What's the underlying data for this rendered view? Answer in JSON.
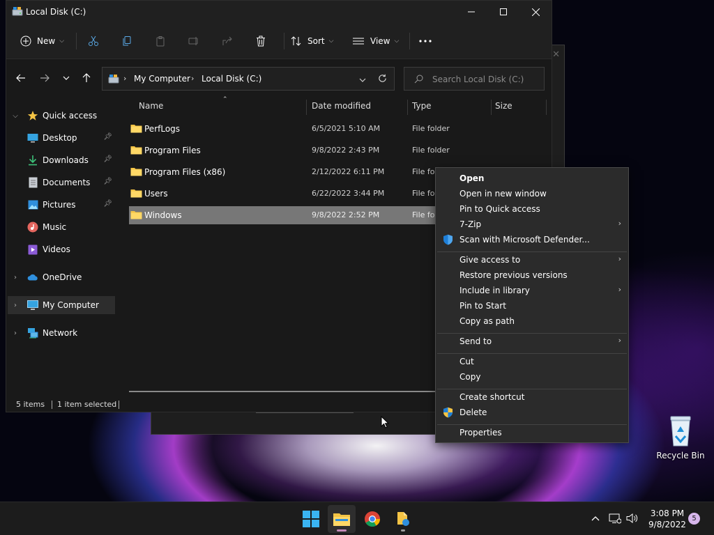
{
  "window": {
    "title": "Local Disk (C:)"
  },
  "toolbar": {
    "new_label": "New",
    "sort_label": "Sort",
    "view_label": "View"
  },
  "address": {
    "crumbs": [
      "My Computer",
      "Local Disk (C:)"
    ]
  },
  "search": {
    "placeholder": "Search Local Disk (C:)"
  },
  "sidebar": {
    "items": [
      {
        "label": "Quick access",
        "icon": "star-icon"
      },
      {
        "label": "Desktop",
        "icon": "desktop-icon",
        "pinned": true
      },
      {
        "label": "Downloads",
        "icon": "download-icon",
        "pinned": true
      },
      {
        "label": "Documents",
        "icon": "document-icon",
        "pinned": true
      },
      {
        "label": "Pictures",
        "icon": "picture-icon",
        "pinned": true
      },
      {
        "label": "Music",
        "icon": "music-icon"
      },
      {
        "label": "Videos",
        "icon": "video-icon"
      },
      {
        "label": "OneDrive",
        "icon": "cloud-icon"
      },
      {
        "label": "My Computer",
        "icon": "computer-icon",
        "selected": true
      },
      {
        "label": "Network",
        "icon": "network-icon"
      }
    ]
  },
  "columns": {
    "name": "Name",
    "date": "Date modified",
    "type": "Type",
    "size": "Size"
  },
  "files": [
    {
      "name": "PerfLogs",
      "date": "6/5/2021 5:10 AM",
      "type": "File folder"
    },
    {
      "name": "Program Files",
      "date": "9/8/2022 2:43 PM",
      "type": "File folder"
    },
    {
      "name": "Program Files (x86)",
      "date": "2/12/2022 6:11 PM",
      "type": "File folder"
    },
    {
      "name": "Users",
      "date": "6/22/2022 3:44 PM",
      "type": "File folder"
    },
    {
      "name": "Windows",
      "date": "9/8/2022 2:52 PM",
      "type": "File folder",
      "selected": true
    }
  ],
  "status": {
    "count": "5 items",
    "selected": "1 item selected"
  },
  "context_menu": {
    "items": [
      {
        "label": "Open"
      },
      {
        "label": "Open in new window"
      },
      {
        "label": "Pin to Quick access"
      },
      {
        "label": "7-Zip"
      },
      {
        "label": "Scan with Microsoft Defender..."
      },
      {
        "label": "Give access to"
      },
      {
        "label": "Restore previous versions"
      },
      {
        "label": "Include in library"
      },
      {
        "label": "Pin to Start"
      },
      {
        "label": "Copy as path"
      },
      {
        "label": "Send to"
      },
      {
        "label": "Cut"
      },
      {
        "label": "Copy"
      },
      {
        "label": "Create shortcut"
      },
      {
        "label": "Delete"
      },
      {
        "label": "Properties"
      }
    ]
  },
  "desktop": {
    "recycle_bin_label": "Recycle Bin"
  },
  "taskbar": {
    "time": "3:08 PM",
    "date": "9/8/2022",
    "notifications": "5"
  },
  "colors": {
    "folder": "#f4c445",
    "selection": "#777777",
    "accent": "#0078d4"
  }
}
